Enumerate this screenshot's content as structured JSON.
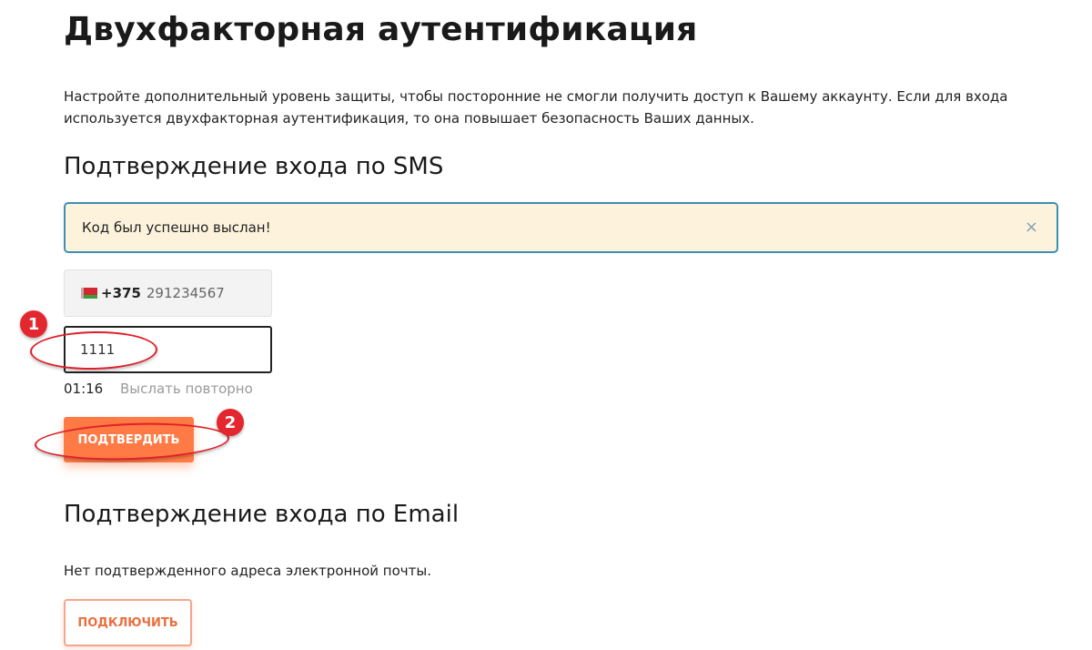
{
  "page": {
    "title": "Двухфакторная аутентификация",
    "intro": "Настройте дополнительный уровень защиты, чтобы посторонние не смогли получить доступ к Вашему аккаунту. Если для входа используется двухфакторная аутентификация, то она повышает безопасность Ваших данных."
  },
  "sms": {
    "title": "Подтверждение входа по SMS",
    "alert_text": "Код был успешно выслан!",
    "alert_close": "×",
    "phone_code": "+375",
    "phone_number": "291234567",
    "code_value": "1111",
    "timer": "01:16",
    "resend_label": "Выслать повторно",
    "confirm_label": "ПОДТВЕРДИТЬ"
  },
  "email": {
    "title": "Подтверждение входа по Email",
    "note": "Нет подтвержденного адреса электронной почты.",
    "connect_label": "ПОДКЛЮЧИТЬ"
  },
  "annotations": {
    "badge_1": "1",
    "badge_2": "2"
  },
  "colors": {
    "accent": "#ff7a45",
    "alert_border": "#3b8fb4",
    "alert_bg": "#fdf3dc",
    "annotation": "#e4272f"
  },
  "icons": {
    "flag": "belarus-flag-icon",
    "close": "close-icon"
  }
}
